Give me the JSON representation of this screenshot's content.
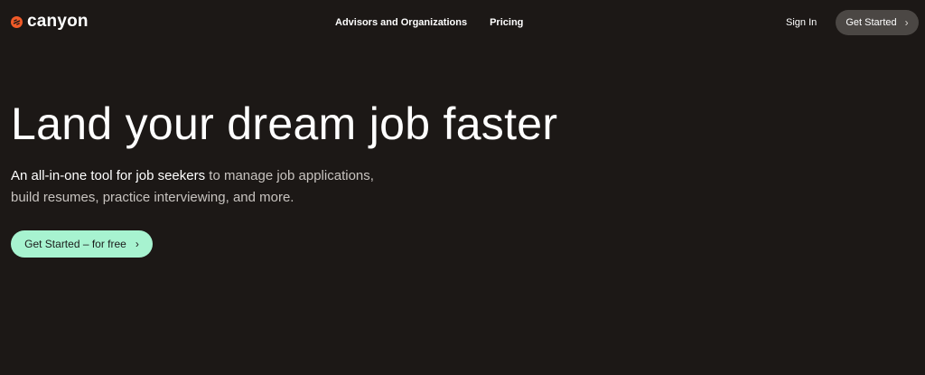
{
  "brand": {
    "name": "canyon",
    "accent": "#f05a28"
  },
  "nav": {
    "links": [
      {
        "label": "Advisors and Organizations"
      },
      {
        "label": "Pricing"
      }
    ],
    "signin": "Sign In",
    "cta": "Get Started",
    "cta_icon": "chevron-right-icon"
  },
  "hero": {
    "title": "Land your dream job faster",
    "subtitle_emphasis": "An all-in-one tool for job seekers",
    "subtitle_rest": " to manage job applications, build resumes, practice interviewing, and more.",
    "cta": "Get Started – for free",
    "cta_color": "#a7f3d0"
  },
  "colors": {
    "background": "#1c1816",
    "nav_button": "#4b4744"
  }
}
